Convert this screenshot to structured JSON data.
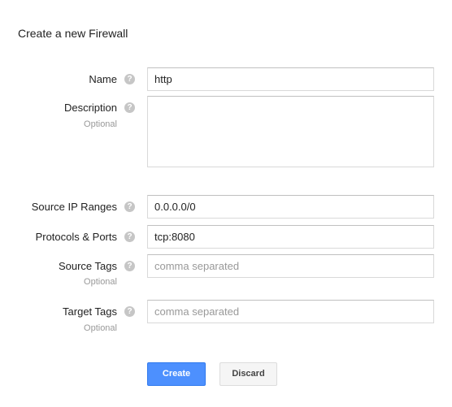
{
  "page": {
    "title": "Create a new Firewall"
  },
  "fields": {
    "name": {
      "label": "Name",
      "value": "http"
    },
    "description": {
      "label": "Description",
      "sublabel": "Optional",
      "value": ""
    },
    "source_ip_ranges": {
      "label": "Source IP Ranges",
      "value": "0.0.0.0/0"
    },
    "protocols_ports": {
      "label": "Protocols & Ports",
      "value": "tcp:8080"
    },
    "source_tags": {
      "label": "Source Tags",
      "sublabel": "Optional",
      "value": "",
      "placeholder": "comma separated"
    },
    "target_tags": {
      "label": "Target Tags",
      "sublabel": "Optional",
      "value": "",
      "placeholder": "comma separated"
    }
  },
  "help_icon": {
    "name": "question-mark-icon",
    "glyph": "?"
  },
  "buttons": {
    "create": "Create",
    "discard": "Discard"
  },
  "colors": {
    "primary_button": "#4d90fe",
    "help_icon": "#c6c6c6",
    "sublabel": "#999999"
  }
}
